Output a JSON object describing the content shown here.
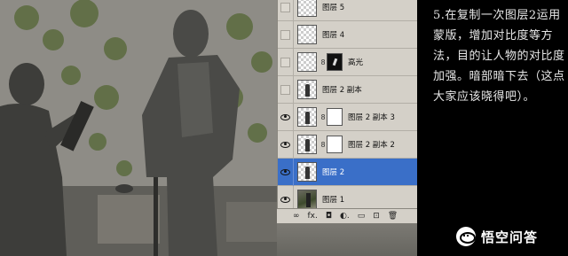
{
  "layers_panel": {
    "layers": [
      {
        "name": "图层 5",
        "visible": false,
        "thumb": "transparent",
        "mask": null,
        "selected": false
      },
      {
        "name": "图层 4",
        "visible": false,
        "thumb": "transparent",
        "mask": null,
        "selected": false
      },
      {
        "name": "高光",
        "visible": false,
        "thumb": "transparent",
        "mask": "dark",
        "selected": false
      },
      {
        "name": "图层 2 副本",
        "visible": false,
        "thumb": "figure",
        "mask": null,
        "selected": false
      },
      {
        "name": "图层 2 副本 3",
        "visible": true,
        "thumb": "figure",
        "mask": "white",
        "selected": false
      },
      {
        "name": "图层 2 副本 2",
        "visible": true,
        "thumb": "figure",
        "mask": "white",
        "selected": false
      },
      {
        "name": "图层 2",
        "visible": true,
        "thumb": "figure",
        "mask": null,
        "selected": true
      },
      {
        "name": "图层 1",
        "visible": true,
        "thumb": "photo",
        "mask": null,
        "selected": false
      }
    ],
    "footer_icons": [
      "link-icon",
      "fx-icon",
      "mask-icon",
      "adjustment-icon",
      "folder-icon",
      "new-layer-icon",
      "trash-icon"
    ],
    "footer_glyphs": [
      "∞",
      "fx.",
      "◘",
      "◐.",
      "▭",
      "⊡",
      "🗑"
    ],
    "selected_color": "#3a6fc8"
  },
  "note": {
    "text": "5.在复制一次图层2运用蒙版，增加对比度等方法，目的让人物的对比度加强。暗部暗下去（这点大家应该晓得吧）。"
  },
  "brand": {
    "text": "悟空问答"
  }
}
